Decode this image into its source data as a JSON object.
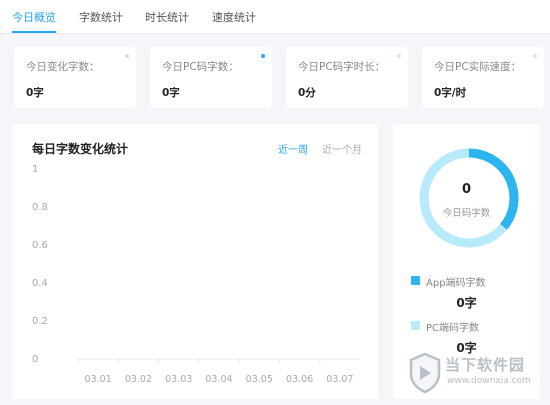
{
  "tabs": [
    {
      "label": "今日概览",
      "active": true
    },
    {
      "label": "字数统计",
      "active": false
    },
    {
      "label": "时长统计",
      "active": false
    },
    {
      "label": "速度统计",
      "active": false
    }
  ],
  "stats": [
    {
      "label": "今日变化字数：",
      "value": "0字",
      "dot_color": "#d8dce2"
    },
    {
      "label": "今日PC码字数：",
      "value": "0字",
      "dot_color": "#2aa5ee"
    },
    {
      "label": "今日PC码字时长：",
      "value": "0分",
      "dot_color": "#c5ecfb"
    },
    {
      "label": "今日PC实际速度：",
      "value": "0字/时",
      "dot_color": "#c5ecfb"
    }
  ],
  "chart_panel": {
    "title": "每日字数变化统计",
    "range_week": "近一周",
    "range_month": "近一个月"
  },
  "chart_data": {
    "type": "line",
    "title": "每日字数变化统计",
    "categories": [
      "03.01",
      "03.02",
      "03.03",
      "03.04",
      "03.05",
      "03.06",
      "03.07"
    ],
    "values": [
      0,
      0,
      0,
      0,
      0,
      0,
      0
    ],
    "yticks": [
      "1",
      "0.8",
      "0.6",
      "0.4",
      "0.2",
      "0"
    ],
    "ylim": [
      0,
      1
    ],
    "xlabel": "",
    "ylabel": "",
    "grid": false,
    "accent_color": "#2aa5ee"
  },
  "donut": {
    "value": "0",
    "caption": "今日码字数",
    "app_share": 0.36,
    "pc_share": 0.64,
    "app_color": "#2db5ef",
    "pc_color": "#b7eafb"
  },
  "legend": [
    {
      "label": "App端码字数",
      "value": "0字",
      "color": "#2db5ef"
    },
    {
      "label": "PC端码字数",
      "value": "0字",
      "color": "#b7eafb"
    }
  ],
  "watermark": {
    "text": "当下软件园",
    "url": "www.downxia.com"
  }
}
